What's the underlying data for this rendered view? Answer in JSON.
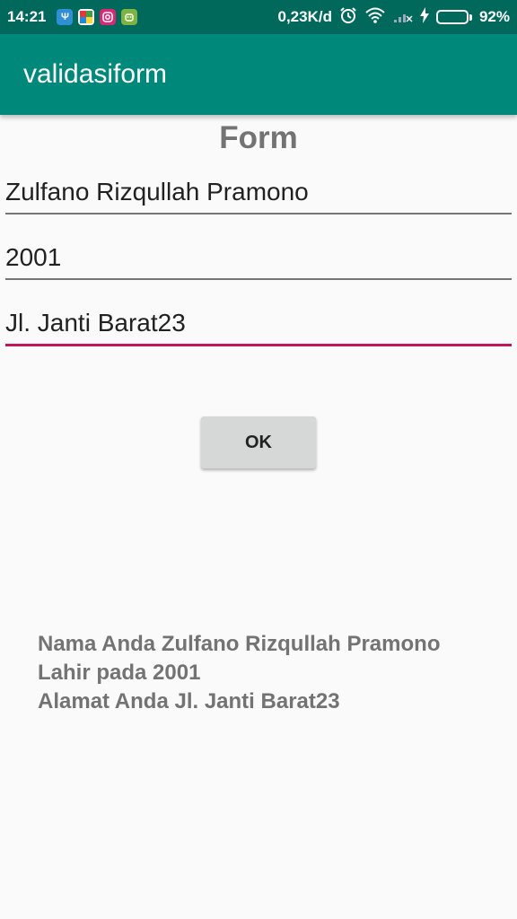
{
  "status_bar": {
    "time": "14:21",
    "network_speed": "0,23K/d",
    "battery_percent": "92%",
    "battery_level": 0.92,
    "notification_icons": [
      "usb-icon",
      "pinwheel-app-icon",
      "instagram-icon",
      "android-app-icon"
    ],
    "right_icons": [
      "alarm-icon",
      "wifi-icon",
      "signal-icon",
      "charging-icon"
    ]
  },
  "app_bar": {
    "title": "validasiform"
  },
  "form": {
    "title": "Form",
    "name_value": "Zulfano Rizqullah Pramono",
    "year_value": "2001",
    "address_value": "Jl. Janti Barat23",
    "ok_label": "OK"
  },
  "result": {
    "line1": "Nama Anda Zulfano Rizqullah Pramono",
    "line2": "Lahir pada 2001",
    "line3": "Alamat Anda Jl. Janti Barat23"
  },
  "colors": {
    "status_bar": "#00695c",
    "app_bar": "#00897b",
    "accent": "#c2185b",
    "button": "#d6d7d7"
  }
}
